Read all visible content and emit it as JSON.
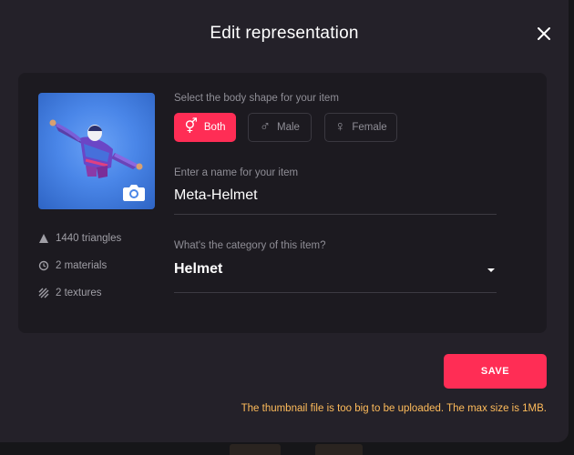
{
  "modal": {
    "title": "Edit representation",
    "close_icon": "close-icon"
  },
  "thumbnail": {
    "camera_icon": "camera-icon",
    "background_color": "#4a86e8"
  },
  "stats": [
    {
      "icon": "triangle-icon",
      "label": "1440 triangles"
    },
    {
      "icon": "materials-icon",
      "label": "2 materials"
    },
    {
      "icon": "textures-icon",
      "label": "2 textures"
    }
  ],
  "body_shape": {
    "label": "Select the body shape for your item",
    "options": [
      {
        "icon": "both-gender-icon",
        "label": "Both",
        "selected": true
      },
      {
        "icon": "male-icon",
        "label": "Male",
        "selected": false
      },
      {
        "icon": "female-icon",
        "label": "Female",
        "selected": false
      }
    ]
  },
  "name_field": {
    "label": "Enter a name for your item",
    "value": "Meta-Helmet"
  },
  "category_field": {
    "label": "What's the category of this item?",
    "value": "Helmet",
    "caret_icon": "chevron-down-icon"
  },
  "save_button": {
    "label": "SAVE"
  },
  "error": {
    "message": "The thumbnail file is too big to be uploaded. The max size is 1MB."
  },
  "colors": {
    "accent": "#ff2d55",
    "warning": "#ffbc5b",
    "modal_bg": "#242129",
    "card_bg": "#1c1a20"
  }
}
